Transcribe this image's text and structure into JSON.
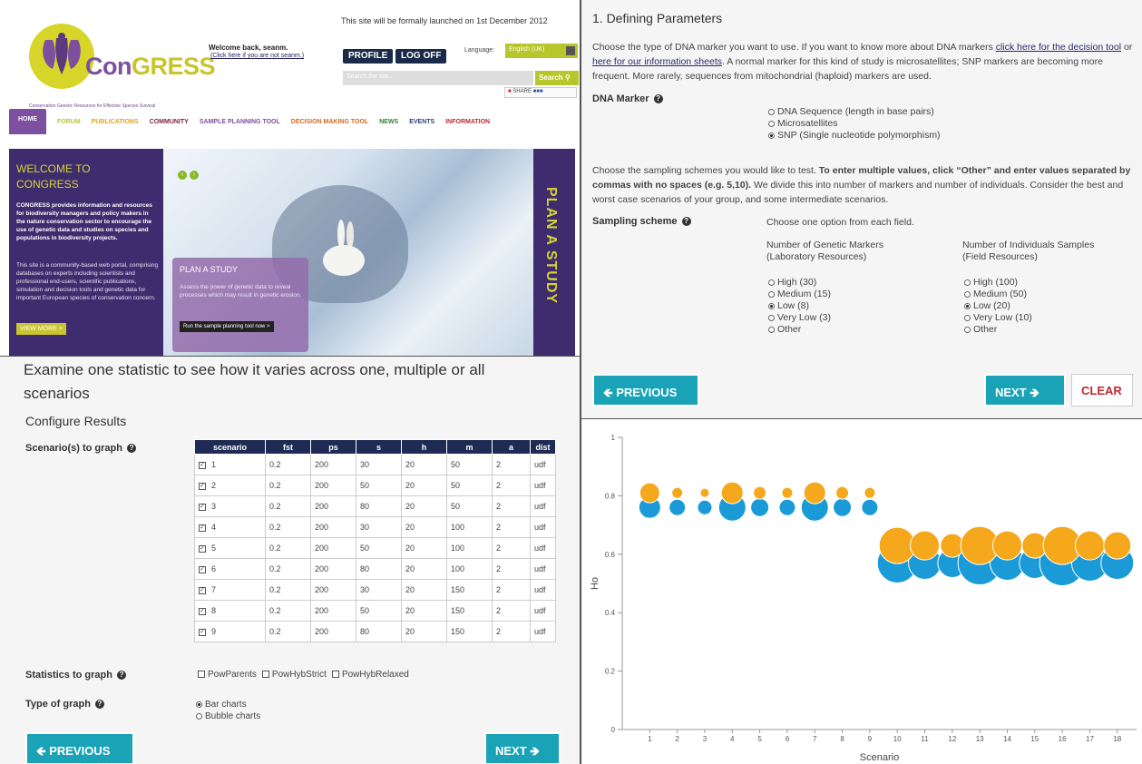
{
  "home": {
    "logo": {
      "con": "Con",
      "gress": "GRESS",
      "tagline": "Conservation Genetic Resources for Effective Species Survival"
    },
    "launch_notice": "This site will be formally launched on 1st December 2012",
    "welcome": "Welcome back, seanm.",
    "not_user": "(Click here if you are not seanm.)",
    "profile_label": "PROFILE",
    "logoff_label": "LOG OFF",
    "language_label": "Language:",
    "language_value": "English (UK)",
    "search_placeholder": "Search the site...",
    "search_label": "Search",
    "share_label": "SHARE",
    "nav": [
      {
        "label": "HOME",
        "color": "#ffffff"
      },
      {
        "label": "FORUM",
        "color": "#b7c62a"
      },
      {
        "label": "PUBLICATIONS",
        "color": "#e8a21a"
      },
      {
        "label": "COMMUNITY",
        "color": "#7d1f3d"
      },
      {
        "label": "SAMPLE PLANNING TOOL",
        "color": "#7d4f9f"
      },
      {
        "label": "DECISION MAKING TOOL",
        "color": "#d2691e"
      },
      {
        "label": "NEWS",
        "color": "#2f7f2f"
      },
      {
        "label": "EVENTS",
        "color": "#2c3d7a"
      },
      {
        "label": "INFORMATION",
        "color": "#c2272d"
      }
    ],
    "hero": {
      "welcome_title_1": "WELCOME TO",
      "welcome_title_2": "CONGRESS",
      "intro": "CONGRESS provides information and resources for biodiversity managers and policy makers in the nature conservation sector to encourage the use of genetic data and studies on species and populations in biodiversity projects.",
      "body": "This site is a community-based web portal, comprising databases on experts including scientists and professional end-users, scientific publications, simulation and decision tools and genetic data for important European species of conservation concern.",
      "view_more": "VIEW MORE >",
      "plan_title": "PLAN A STUDY",
      "plan_desc": "Assess the power of genetic data to reveal processes which may result in genetic erosion.",
      "plan_button": "Run the sample planning tool now >",
      "plan_vertical": "PLAN A STUDY"
    }
  },
  "results": {
    "title": "Examine one statistic to see how it varies across one, multiple or all scenarios",
    "subtitle": "Configure Results",
    "scenarios_label": "Scenario(s) to graph",
    "columns": [
      "scenario",
      "fst",
      "ps",
      "s",
      "h",
      "m",
      "a",
      "dist"
    ],
    "rows": [
      [
        "1",
        "0.2",
        "200",
        "30",
        "20",
        "50",
        "2",
        "udf"
      ],
      [
        "2",
        "0.2",
        "200",
        "50",
        "20",
        "50",
        "2",
        "udf"
      ],
      [
        "3",
        "0.2",
        "200",
        "80",
        "20",
        "50",
        "2",
        "udf"
      ],
      [
        "4",
        "0.2",
        "200",
        "30",
        "20",
        "100",
        "2",
        "udf"
      ],
      [
        "5",
        "0.2",
        "200",
        "50",
        "20",
        "100",
        "2",
        "udf"
      ],
      [
        "6",
        "0.2",
        "200",
        "80",
        "20",
        "100",
        "2",
        "udf"
      ],
      [
        "7",
        "0.2",
        "200",
        "30",
        "20",
        "150",
        "2",
        "udf"
      ],
      [
        "8",
        "0.2",
        "200",
        "50",
        "20",
        "150",
        "2",
        "udf"
      ],
      [
        "9",
        "0.2",
        "200",
        "80",
        "20",
        "150",
        "2",
        "udf"
      ]
    ],
    "statistics_label": "Statistics to graph",
    "statistics_options": [
      "PowParents",
      "PowHybStrict",
      "PowHybRelaxed"
    ],
    "graph_type_label": "Type of graph",
    "graph_types": [
      "Bar charts",
      "Bubble charts"
    ],
    "previous_label": "PREVIOUS",
    "next_label": "NEXT"
  },
  "params": {
    "title": "1. Defining Parameters",
    "intro_1": "Choose the type of DNA marker you want to use. If you want to know more about DNA markers ",
    "intro_link1": "click here for the decision tool",
    "intro_2": " or ",
    "intro_link2": "here for our information sheets",
    "intro_3": ". A normal marker for this kind of study is microsatellites; SNP markers are becoming more frequent. More rarely, sequences from mitochondrial (haploid) markers are used.",
    "dna_label": "DNA Marker",
    "dna_options": [
      "DNA Sequence (length in base pairs)",
      "Microsatellites",
      "SNP (Single nucleotide polymorphism)"
    ],
    "dna_selected": 2,
    "sampling_text_1": "Choose the sampling schemes you would like to test. ",
    "sampling_text_bold": "To enter multiple values, click “Other” and enter values separated by commas with no spaces (e.g. 5,10).",
    "sampling_text_2": " We divide this into number of markers and number of individuals. Consider the best and worst case scenarios of your group, and some intermediate scenarios.",
    "sampling_label": "Sampling scheme",
    "choose_one": "Choose one option from each field.",
    "markers_head_1": "Number of Genetic Markers",
    "markers_head_2": "(Laboratory Resources)",
    "markers_options": [
      "High (30)",
      "Medium (15)",
      "Low (8)",
      "Very Low (3)",
      "Other"
    ],
    "markers_selected": 2,
    "indiv_head_1": "Number of Individuals Samples",
    "indiv_head_2": "(Field Resources)",
    "indiv_options": [
      "High (100)",
      "Medium (50)",
      "Low (20)",
      "Very Low (10)",
      "Other"
    ],
    "indiv_selected": 2,
    "previous_label": "PREVIOUS",
    "next_label": "NEXT",
    "clear_label": "CLEAR"
  },
  "chart_data": {
    "type": "scatter",
    "xlabel": "Scenario",
    "ylabel": "Ho",
    "xlim": [
      0,
      18.7
    ],
    "ylim": [
      0,
      1
    ],
    "x_ticks": [
      1,
      2,
      3,
      4,
      5,
      6,
      7,
      8,
      9,
      10,
      11,
      12,
      13,
      14,
      15,
      16,
      17,
      18
    ],
    "y_ticks": [
      0,
      0.2,
      0.4,
      0.6,
      0.8,
      1
    ],
    "colors": {
      "upper": "#f5a81c",
      "lower": "#1a9bd7"
    },
    "series": [
      {
        "points": [
          {
            "x": 1,
            "y": 0.81,
            "r": 11
          },
          {
            "x": 2,
            "y": 0.81,
            "r": 6
          },
          {
            "x": 3,
            "y": 0.81,
            "r": 5
          },
          {
            "x": 4,
            "y": 0.81,
            "r": 12
          },
          {
            "x": 5,
            "y": 0.81,
            "r": 7
          },
          {
            "x": 6,
            "y": 0.81,
            "r": 6
          },
          {
            "x": 7,
            "y": 0.81,
            "r": 12
          },
          {
            "x": 8,
            "y": 0.81,
            "r": 7
          },
          {
            "x": 9,
            "y": 0.81,
            "r": 6
          },
          {
            "x": 10,
            "y": 0.63,
            "r": 20
          },
          {
            "x": 11,
            "y": 0.63,
            "r": 16
          },
          {
            "x": 12,
            "y": 0.63,
            "r": 13
          },
          {
            "x": 13,
            "y": 0.63,
            "r": 21
          },
          {
            "x": 14,
            "y": 0.63,
            "r": 16
          },
          {
            "x": 15,
            "y": 0.63,
            "r": 14
          },
          {
            "x": 16,
            "y": 0.63,
            "r": 21
          },
          {
            "x": 17,
            "y": 0.63,
            "r": 16
          },
          {
            "x": 18,
            "y": 0.63,
            "r": 15
          }
        ]
      },
      {
        "points": [
          {
            "x": 1,
            "y": 0.76,
            "r": 12
          },
          {
            "x": 2,
            "y": 0.76,
            "r": 9
          },
          {
            "x": 3,
            "y": 0.76,
            "r": 8
          },
          {
            "x": 4,
            "y": 0.76,
            "r": 15
          },
          {
            "x": 5,
            "y": 0.76,
            "r": 10
          },
          {
            "x": 6,
            "y": 0.76,
            "r": 9
          },
          {
            "x": 7,
            "y": 0.76,
            "r": 15
          },
          {
            "x": 8,
            "y": 0.76,
            "r": 10
          },
          {
            "x": 9,
            "y": 0.76,
            "r": 9
          },
          {
            "x": 10,
            "y": 0.57,
            "r": 22
          },
          {
            "x": 11,
            "y": 0.57,
            "r": 18
          },
          {
            "x": 12,
            "y": 0.57,
            "r": 16
          },
          {
            "x": 13,
            "y": 0.57,
            "r": 24
          },
          {
            "x": 14,
            "y": 0.57,
            "r": 19
          },
          {
            "x": 15,
            "y": 0.57,
            "r": 17
          },
          {
            "x": 16,
            "y": 0.57,
            "r": 25
          },
          {
            "x": 17,
            "y": 0.57,
            "r": 20
          },
          {
            "x": 18,
            "y": 0.57,
            "r": 18
          }
        ]
      }
    ]
  }
}
